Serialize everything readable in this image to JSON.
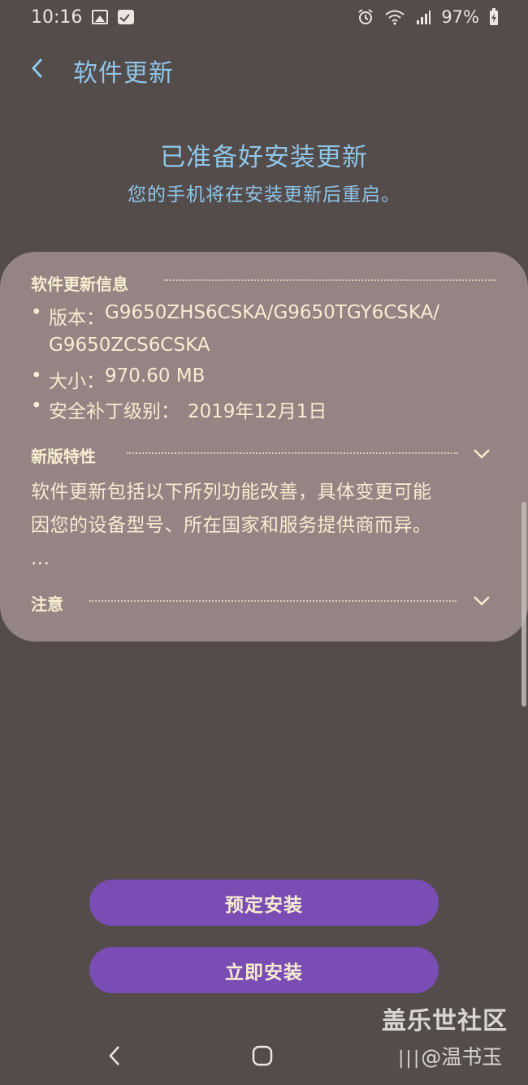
{
  "status_bar": {
    "time": "10:16",
    "battery": "97%",
    "icons": [
      "image-icon",
      "checkbox-icon",
      "alarm-icon",
      "wifi-icon",
      "signal-icon",
      "battery-charging-icon"
    ]
  },
  "header": {
    "title": "软件更新",
    "back_icon": "chevron-left-icon"
  },
  "ready": {
    "title": "已准备好安装更新",
    "subtitle": "您的手机将在安装更新后重启。"
  },
  "update_info": {
    "heading": "软件更新信息",
    "version_label": "版本：",
    "version_line1": "G9650ZHS6CSKA/G9650TGY6CSKA/",
    "version_line2": "G9650ZCS6CSKA",
    "size_label": "大小：",
    "size_value": "970.60 MB",
    "patch_label": "安全补丁级别：",
    "patch_value": "2019年12月1日"
  },
  "features": {
    "heading": "新版特性",
    "line1": "软件更新包括以下所列功能改善，具体变更可能",
    "line2": "因您的设备型号、所在国家和服务提供商而异。",
    "ellipsis": "..."
  },
  "notice": {
    "heading": "注意"
  },
  "buttons": {
    "schedule": "预定安装",
    "install_now": "立即安装"
  },
  "watermark": {
    "line1": "盖乐世社区",
    "line2": "@温书玉"
  },
  "colors": {
    "background": "#544b4b",
    "card": "#948484",
    "accent_blue": "#8fc6e8",
    "button_purple": "#7a4db5",
    "text_cream": "#f7edd0"
  }
}
